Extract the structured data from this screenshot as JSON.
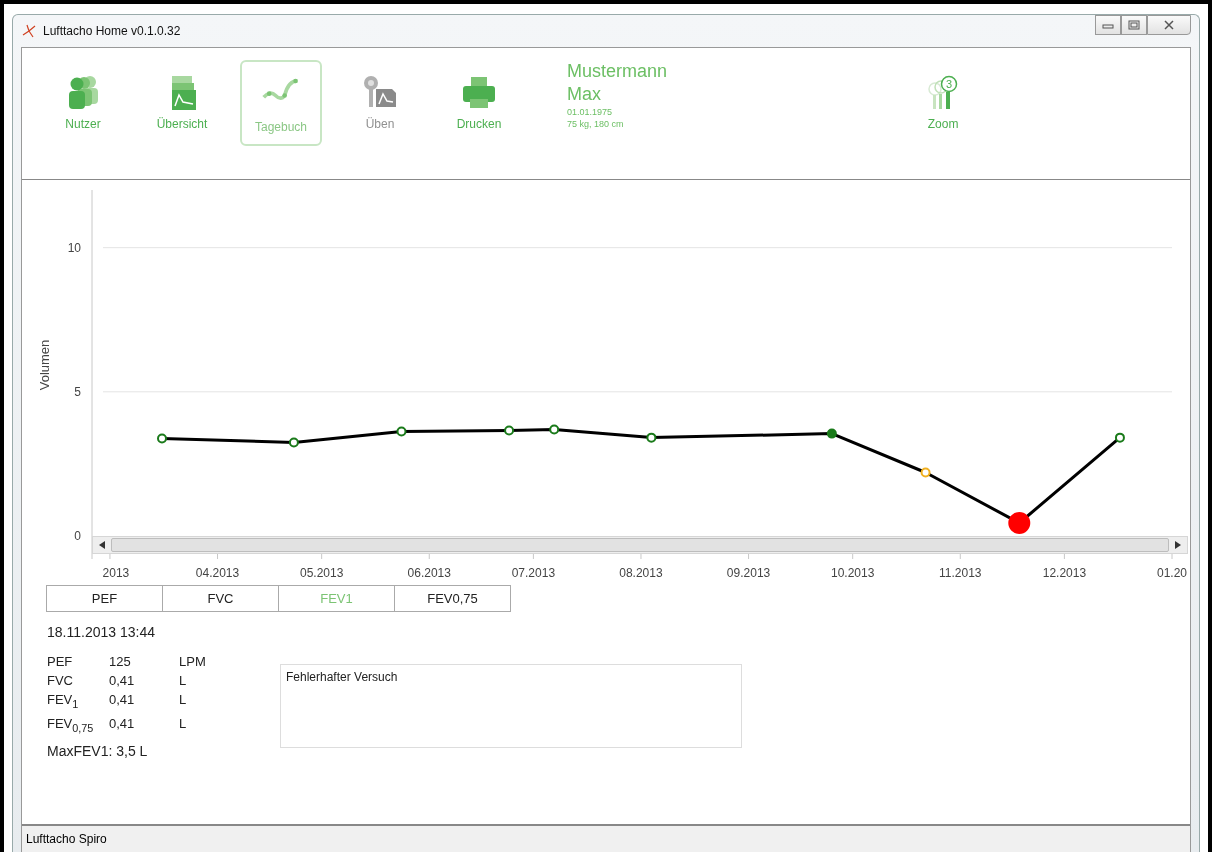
{
  "window": {
    "title": "Lufttacho Home v0.1.0.32"
  },
  "toolbar": [
    {
      "kind": "users",
      "label": "Nutzer",
      "selected": false,
      "disabled": false
    },
    {
      "kind": "overview",
      "label": "Übersicht",
      "selected": false,
      "disabled": false
    },
    {
      "kind": "diary",
      "label": "Tagebuch",
      "selected": true,
      "disabled": false
    },
    {
      "kind": "practice",
      "label": "Üben",
      "selected": false,
      "disabled": true
    },
    {
      "kind": "print",
      "label": "Drucken",
      "selected": false,
      "disabled": false
    }
  ],
  "patient": {
    "last_name": "Mustermann",
    "first_name": "Max",
    "birth_date": "01.01.1975",
    "body": "75 kg,  180 cm"
  },
  "zoom": {
    "label": "Zoom",
    "badge": "3"
  },
  "chart_data": {
    "type": "line",
    "ylabel": "Volumen",
    "x": [
      "2013-03-16",
      "2013-04-23",
      "2013-05-24",
      "2013-06-24",
      "2013-07-07",
      "2013-08-04",
      "2013-09-25",
      "2013-10-22",
      "2013-11-18",
      "2013-12-17"
    ],
    "series": [
      {
        "color": "#000000",
        "marker": true,
        "values": [
          3.38,
          3.24,
          3.62,
          3.66,
          3.69,
          3.41,
          3.55,
          2.2,
          0.45,
          3.41
        ]
      }
    ],
    "xlim": [
      "2013-02-27",
      "2014-01-01"
    ],
    "ylim": [
      -0.8,
      12
    ],
    "yticks": [
      0,
      5,
      10
    ],
    "xticks": [
      {
        "value": "2013-03-01",
        "label": "2013"
      },
      {
        "value": "2013-04-01",
        "label": "04.2013"
      },
      {
        "value": "2013-05-01",
        "label": "05.2013"
      },
      {
        "value": "2013-06-01",
        "label": "06.2013"
      },
      {
        "value": "2013-07-01",
        "label": "07.2013"
      },
      {
        "value": "2013-08-01",
        "label": "08.2013"
      },
      {
        "value": "2013-09-01",
        "label": "09.2013"
      },
      {
        "value": "2013-10-01",
        "label": "10.2013"
      },
      {
        "value": "2013-11-01",
        "label": "11.2013"
      },
      {
        "value": "2013-12-01",
        "label": "12.2013"
      },
      {
        "value": "2014-01-01",
        "label": "01.20"
      }
    ]
  },
  "markers": [
    {
      "kind": "hollow",
      "color": "#1a7a1a"
    },
    {
      "kind": "hollow",
      "color": "#1a7a1a"
    },
    {
      "kind": "hollow",
      "color": "#1a7a1a"
    },
    {
      "kind": "hollow",
      "color": "#1a7a1a"
    },
    {
      "kind": "hollow",
      "color": "#1a7a1a"
    },
    {
      "kind": "hollow",
      "color": "#1a7a1a"
    },
    {
      "kind": "filled",
      "color": "#1a7a1a"
    },
    {
      "kind": "hollow",
      "color": "#f0b020"
    },
    {
      "kind": "large",
      "color": "#ff0000"
    },
    {
      "kind": "hollow",
      "color": "#1a7a1a"
    }
  ],
  "metric_tabs": [
    {
      "label": "PEF",
      "selected": false
    },
    {
      "label": "FVC",
      "selected": false
    },
    {
      "label": "FEV1",
      "selected": true
    },
    {
      "label": "FEV0,75",
      "selected": false
    }
  ],
  "measurement": {
    "timestamp": "18.11.2013 13:44",
    "rows": [
      {
        "name": "PEF",
        "value": "125",
        "unit": "LPM"
      },
      {
        "name": "FVC",
        "value": "0,41",
        "unit": "L"
      },
      {
        "name": "FEV$_{1}$",
        "value": "0,41",
        "unit": "L"
      },
      {
        "name": "FEV$_{0,75}$",
        "value": "0,41",
        "unit": "L"
      }
    ],
    "max": "MaxFEV1: 3,5 L",
    "comment": "Fehlerhafter Versuch"
  },
  "status_bar": "Lufttacho Spiro"
}
